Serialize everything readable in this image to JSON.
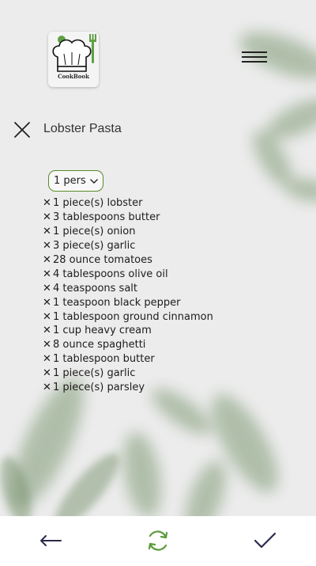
{
  "logo": {
    "text": "CookBook",
    "icon": "chef-hat-icon"
  },
  "header": {
    "menu_icon": "hamburger-menu-icon"
  },
  "recipe": {
    "title": "Lobster Pasta",
    "close_icon": "close-icon"
  },
  "servings": {
    "selected": "1 pers",
    "icon": "chevron-down-icon"
  },
  "ingredients": [
    "1 piece(s) lobster",
    "3 tablespoons butter",
    "1 piece(s) onion",
    "3 piece(s) garlic",
    "28 ounce tomatoes",
    "4 tablespoons olive oil",
    "4 teaspoons salt",
    "1 teaspoon black pepper",
    "1 tablespoon ground cinnamon",
    "1 cup heavy cream",
    "8 ounce spaghetti",
    "1 tablespoon butter",
    "1 piece(s) garlic",
    "1 piece(s) parsley"
  ],
  "remove_glyph": "✕",
  "bottom_nav": {
    "back_icon": "arrow-left-icon",
    "refresh_icon": "refresh-icon",
    "confirm_icon": "checkmark-icon"
  },
  "colors": {
    "accent": "#5a8a2a",
    "background": "#ececec",
    "leaf": "#7d9a72"
  }
}
